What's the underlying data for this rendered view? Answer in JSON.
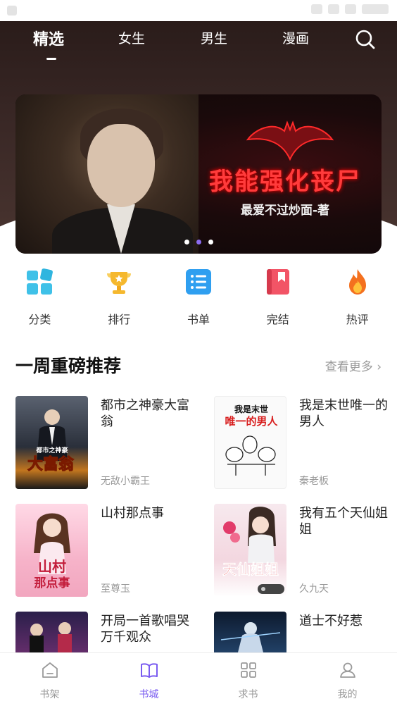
{
  "tabs": [
    {
      "label": "精选",
      "active": true
    },
    {
      "label": "女生",
      "active": false
    },
    {
      "label": "男生",
      "active": false
    },
    {
      "label": "漫画",
      "active": false
    }
  ],
  "banner": {
    "title": "我能强化丧尸",
    "author": "最爱不过炒面-著",
    "pages": 3,
    "current_page": 2
  },
  "categories": [
    {
      "label": "分类",
      "icon": "grid-icon",
      "color": "#3fc1e8"
    },
    {
      "label": "排行",
      "icon": "trophy-icon",
      "color": "#f5b82e"
    },
    {
      "label": "书单",
      "icon": "list-icon",
      "color": "#2f9ff0"
    },
    {
      "label": "完结",
      "icon": "bookmark-book-icon",
      "color": "#f25466"
    },
    {
      "label": "热评",
      "icon": "flame-icon",
      "color": "#f4711f"
    }
  ],
  "section": {
    "title": "一周重磅推荐",
    "more": "查看更多"
  },
  "books": [
    {
      "title": "都市之神豪大富翁",
      "author": "无敌小霸王",
      "cover_text": "都市之神豪 大富翁"
    },
    {
      "title": "我是末世唯一的男人",
      "author": "秦老板",
      "cover_text": "我是末世 唯一的男人"
    },
    {
      "title": "山村那点事",
      "author": "至尊玉",
      "cover_text": "山村 那点事"
    },
    {
      "title": "我有五个天仙姐姐",
      "author": "久九天",
      "cover_text": "天仙姐姐"
    },
    {
      "title": "开局一首歌唱哭万千观众",
      "author": "",
      "cover_text": ""
    },
    {
      "title": "道士不好惹",
      "author": "",
      "cover_text": ""
    }
  ],
  "bottom_nav": [
    {
      "label": "书架",
      "icon": "bookshelf-icon",
      "active": false
    },
    {
      "label": "书城",
      "icon": "open-book-icon",
      "active": true
    },
    {
      "label": "求书",
      "icon": "apps-grid-icon",
      "active": false
    },
    {
      "label": "我的",
      "icon": "user-icon",
      "active": false
    }
  ],
  "accent_color": "#7a5cf0"
}
